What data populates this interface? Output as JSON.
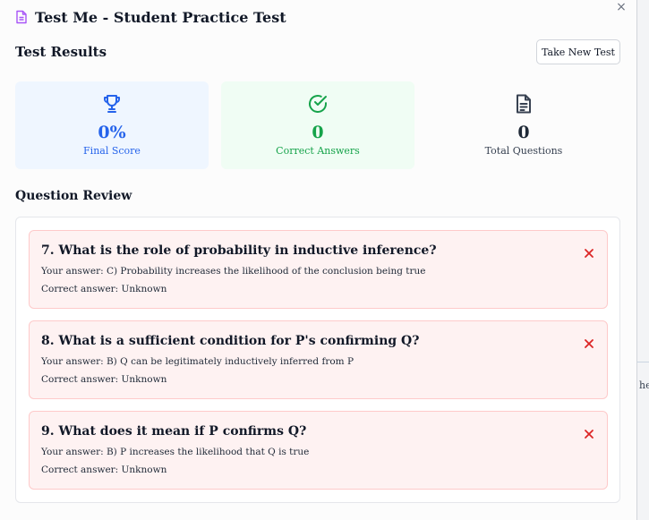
{
  "window": {
    "title": "Test Me - Student Practice Test",
    "close_glyph": "×"
  },
  "results": {
    "heading": "Test Results",
    "new_test_label": "Take New Test",
    "stats": [
      {
        "value": "0%",
        "label": "Final Score",
        "icon": "trophy-icon",
        "color": "#2563eb"
      },
      {
        "value": "0",
        "label": "Correct Answers",
        "icon": "check-circle-icon",
        "color": "#16a34a"
      },
      {
        "value": "0",
        "label": "Total Questions",
        "icon": "document-icon",
        "color": "#374151"
      }
    ]
  },
  "review": {
    "heading": "Question Review",
    "questions": [
      {
        "title": "7. What is the role of probability in inductive inference?",
        "your_answer": "Your answer: C) Probability increases the likelihood of the conclusion being true",
        "correct_answer": "Correct answer: Unknown",
        "status": "incorrect"
      },
      {
        "title": "8. What is a sufficient condition for P's confirming Q?",
        "your_answer": "Your answer: B) Q can be legitimately inductively inferred from P",
        "correct_answer": "Correct answer: Unknown",
        "status": "incorrect"
      },
      {
        "title": "9. What does it mean if P confirms Q?",
        "your_answer": "Your answer: B) P increases the likelihood that Q is true",
        "correct_answer": "Correct answer: Unknown",
        "status": "incorrect"
      }
    ]
  },
  "backdrop": {
    "peek_text": "he"
  },
  "colors": {
    "incorrect_bg": "#fef2f2",
    "incorrect_border": "#fecaca",
    "incorrect_icon": "#dc2626",
    "accent": "#a855f7"
  }
}
